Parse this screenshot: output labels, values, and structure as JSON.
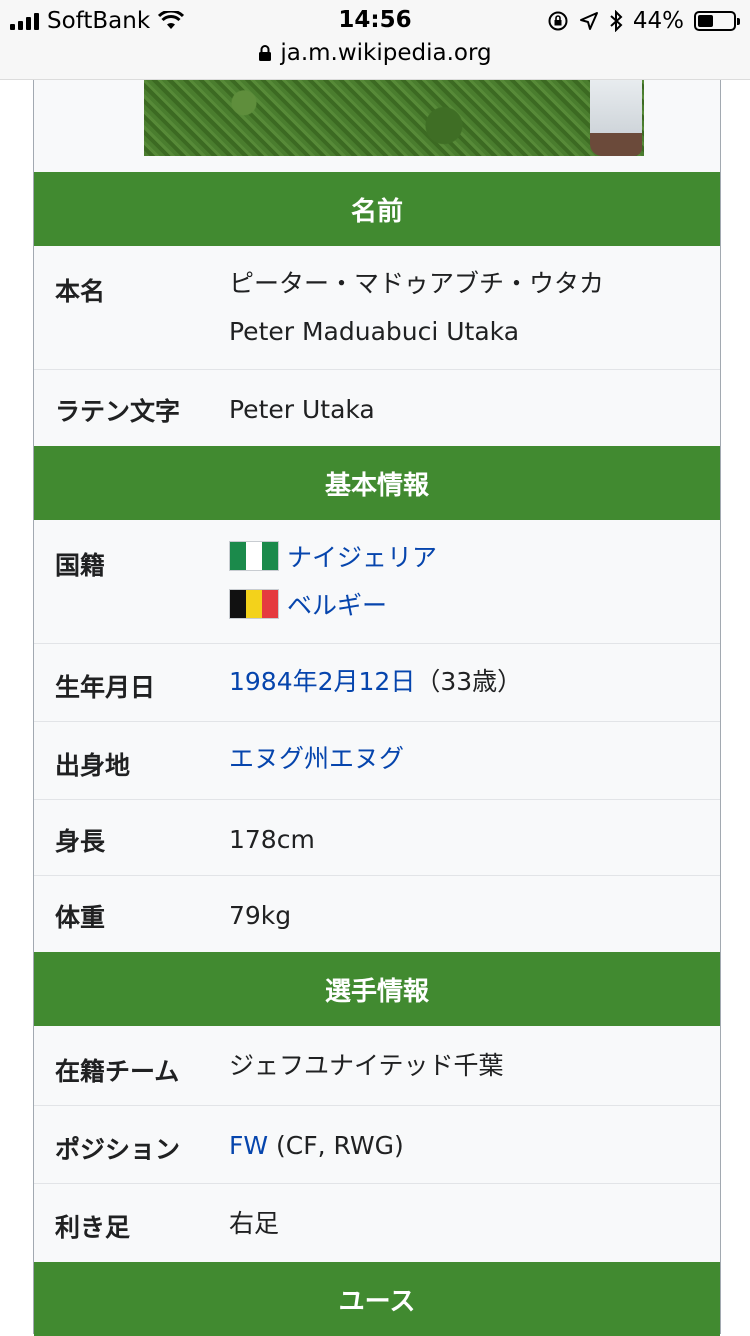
{
  "status_bar": {
    "carrier": "SoftBank",
    "time": "14:56",
    "battery": "44%",
    "battery_level": 0.44,
    "url": "ja.m.wikipedia.org"
  },
  "colors": {
    "section_header": "#418a30",
    "link": "#0645ad",
    "row_background": "#f8f9fa"
  },
  "infobox": {
    "section_name": "名前",
    "real_name_label": "本名",
    "real_name_ja": "ピーター・マドゥアブチ・ウタカ",
    "real_name_en": "Peter Maduabuci Utaka",
    "latin_label": "ラテン文字",
    "latin_value": "Peter Utaka",
    "section_basic": "基本情報",
    "nationality_label": "国籍",
    "nationality_1": "ナイジェリア",
    "nationality_2": "ベルギー",
    "birthdate_label": "生年月日",
    "birthdate_link": "1984年2月12日",
    "birthdate_age": "（33歳）",
    "birthplace_label": "出身地",
    "birthplace_value": "エヌグ州エヌグ",
    "height_label": "身長",
    "height_value": "178cm",
    "weight_label": "体重",
    "weight_value": "79kg",
    "section_player": "選手情報",
    "team_label": "在籍チーム",
    "team_value": "ジェフユナイテッド千葉",
    "position_label": "ポジション",
    "position_link": "FW",
    "position_rest": " (CF, RWG)",
    "foot_label": "利き足",
    "foot_value": "右足",
    "section_youth": "ユース"
  }
}
